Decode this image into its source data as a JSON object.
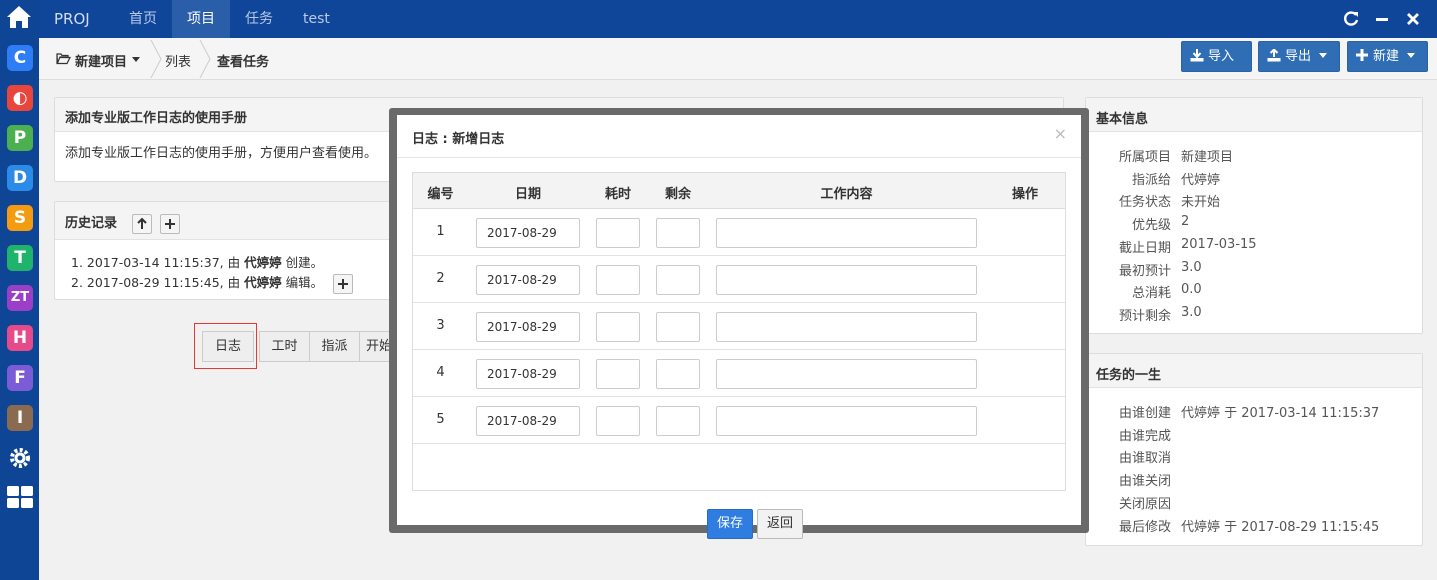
{
  "topbar": {
    "brand": "PROJ",
    "nav": [
      "首页",
      "项目",
      "任务",
      "test"
    ],
    "active_nav": 1
  },
  "dock": {
    "items": [
      {
        "glyph": "C",
        "color": "#2e7cf6"
      },
      {
        "glyph": "◐",
        "color": "#e8453c"
      },
      {
        "glyph": "P",
        "color": "#4caf50"
      },
      {
        "glyph": "D",
        "color": "#2b8be6"
      },
      {
        "glyph": "S",
        "color": "#f39c12"
      },
      {
        "glyph": "T",
        "color": "#1fb36b"
      },
      {
        "glyph": "ZT",
        "color": "#9b3fc9"
      },
      {
        "glyph": "H",
        "color": "#e64a8b"
      },
      {
        "glyph": "F",
        "color": "#7b5cd6"
      },
      {
        "glyph": "I",
        "color": "#8a6b4f"
      }
    ]
  },
  "breadcrumb": {
    "root": "新建项目",
    "list": "列表",
    "current": "查看任务"
  },
  "toolbar": {
    "import_label": "导入",
    "export_label": "导出",
    "new_label": "新建"
  },
  "desc_panel": {
    "title": "添加专业版工作日志的使用手册",
    "body": "添加专业版工作日志的使用手册，方便用户查看使用。"
  },
  "history": {
    "title": "历史记录",
    "entries": [
      {
        "prefix": "1. 2017-03-14 11:15:37, 由 ",
        "user": "代婷婷",
        "action": " 创建。"
      },
      {
        "prefix": "2. 2017-08-29 11:15:45, 由 ",
        "user": "代婷婷",
        "action": " 编辑。"
      }
    ]
  },
  "actions": {
    "log": "日志",
    "hours": "工时",
    "assign": "指派",
    "start": "开始"
  },
  "basic_info": {
    "title": "基本信息",
    "rows": [
      {
        "k": "所属项目",
        "v": "新建项目"
      },
      {
        "k": "指派给",
        "v": "代婷婷"
      },
      {
        "k": "任务状态",
        "v": "未开始"
      },
      {
        "k": "优先级",
        "v": "2"
      },
      {
        "k": "截止日期",
        "v": "2017-03-15"
      },
      {
        "k": "最初预计",
        "v": "3.0"
      },
      {
        "k": "总消耗",
        "v": "0.0"
      },
      {
        "k": "预计剩余",
        "v": "3.0"
      }
    ]
  },
  "life_info": {
    "title": "任务的一生",
    "rows": [
      {
        "k": "由谁创建",
        "v": "代婷婷 于 2017-03-14 11:15:37"
      },
      {
        "k": "由谁完成",
        "v": ""
      },
      {
        "k": "由谁取消",
        "v": ""
      },
      {
        "k": "由谁关闭",
        "v": ""
      },
      {
        "k": "关闭原因",
        "v": ""
      },
      {
        "k": "最后修改",
        "v": "代婷婷 于 2017-08-29 11:15:45"
      }
    ]
  },
  "modal": {
    "title": "日志 : 新增日志",
    "close_glyph": "×",
    "columns": {
      "num": "编号",
      "date": "日期",
      "consumed": "耗时",
      "left": "剩余",
      "work": "工作内容",
      "ops": "操作"
    },
    "rows": [
      {
        "num": "1",
        "date": "2017-08-29",
        "consumed": "",
        "left": "",
        "work": ""
      },
      {
        "num": "2",
        "date": "2017-08-29",
        "consumed": "",
        "left": "",
        "work": ""
      },
      {
        "num": "3",
        "date": "2017-08-29",
        "consumed": "",
        "left": "",
        "work": ""
      },
      {
        "num": "4",
        "date": "2017-08-29",
        "consumed": "",
        "left": "",
        "work": ""
      },
      {
        "num": "5",
        "date": "2017-08-29",
        "consumed": "",
        "left": "",
        "work": ""
      }
    ],
    "save_label": "保存",
    "back_label": "返回"
  },
  "colors": {
    "nav_bg": "#0f4699",
    "primary": "#2f6db5",
    "save": "#2f7de1",
    "highlight": "#e53935"
  }
}
